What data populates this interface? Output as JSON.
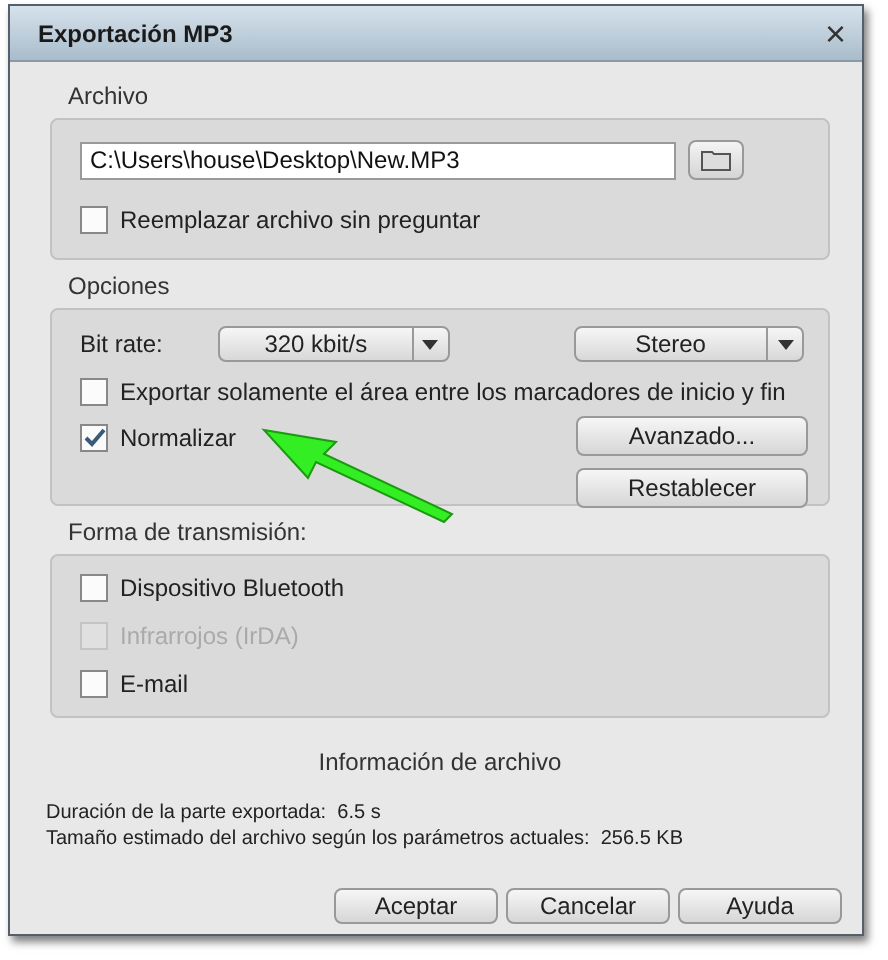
{
  "window": {
    "title": "Exportación MP3",
    "close": "×"
  },
  "archivo": {
    "legend": "Archivo",
    "path": "C:\\Users\\house\\Desktop\\New.MP3",
    "checkbox": {
      "label": "Reemplazar archivo sin preguntar",
      "checked": false,
      "disabled": false
    }
  },
  "opciones": {
    "legend": "Opciones",
    "bitrate_label": "Bit rate:",
    "bitrate": "320 kbit/s",
    "channels": "Stereo",
    "checkboxes": [
      {
        "label": "Exportar solamente el área entre los marcadores de inicio y fin",
        "checked": false,
        "disabled": false
      },
      {
        "label": "Normalizar",
        "checked": true,
        "disabled": false
      }
    ],
    "buttons": [
      "Avanzado...",
      "Restablecer"
    ]
  },
  "transmision": {
    "legend": "Forma de transmisión:",
    "checkboxes": [
      {
        "label": "Dispositivo Bluetooth",
        "checked": false,
        "disabled": false
      },
      {
        "label": "Infrarrojos (IrDA)",
        "checked": false,
        "disabled": true
      },
      {
        "label": "E-mail",
        "checked": false,
        "disabled": false
      }
    ]
  },
  "info": {
    "title": "Información de archivo",
    "lines": [
      "Duración de la parte exportada:  6.5 s",
      "Tamaño estimado del archivo según los parámetros actuales:  256.5 KB"
    ]
  },
  "buttons": [
    "Aceptar",
    "Cancelar",
    "Ayuda"
  ]
}
